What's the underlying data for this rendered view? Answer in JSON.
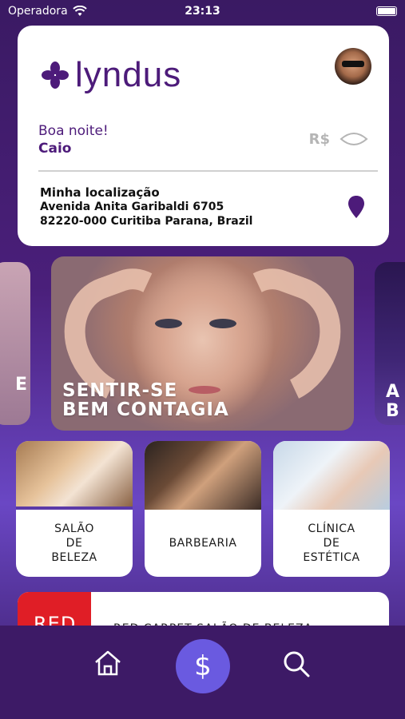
{
  "status_bar": {
    "carrier": "Operadora",
    "time": "23:13"
  },
  "header": {
    "logo_text": "lyndus",
    "greeting": "Boa noite!",
    "user_name": "Caio",
    "currency": "R$",
    "location_title": "Minha localização",
    "address_line1": "Avenida Anita Garibaldi 6705",
    "address_line2": "82220-000 Curitiba Parana, Brazil"
  },
  "banners": {
    "left_peek_text": "E",
    "main_line1": "SENTIR-SE",
    "main_line2": "BEM CONTAGIA",
    "right_peek_line1": "A",
    "right_peek_line2": "B"
  },
  "categories": [
    {
      "label": "SALÃO\nDE\nBELEZA"
    },
    {
      "label": "BARBEARIA"
    },
    {
      "label": "CLÍNICA\nDE\nESTÉTICA"
    }
  ],
  "listing": {
    "thumb_text": "RED",
    "title": "RED CARPET SALÃO DE BELEZA"
  },
  "tab_bar": {
    "money_symbol": "$"
  },
  "colors": {
    "brand": "#4d1b7a",
    "accent": "#6a5ae0",
    "tab_bar_bg": "#3d1a66"
  },
  "icons": [
    "wifi-icon",
    "battery-icon",
    "logo-flower-icon",
    "eye-icon",
    "location-pin-icon",
    "home-icon",
    "search-icon"
  ]
}
